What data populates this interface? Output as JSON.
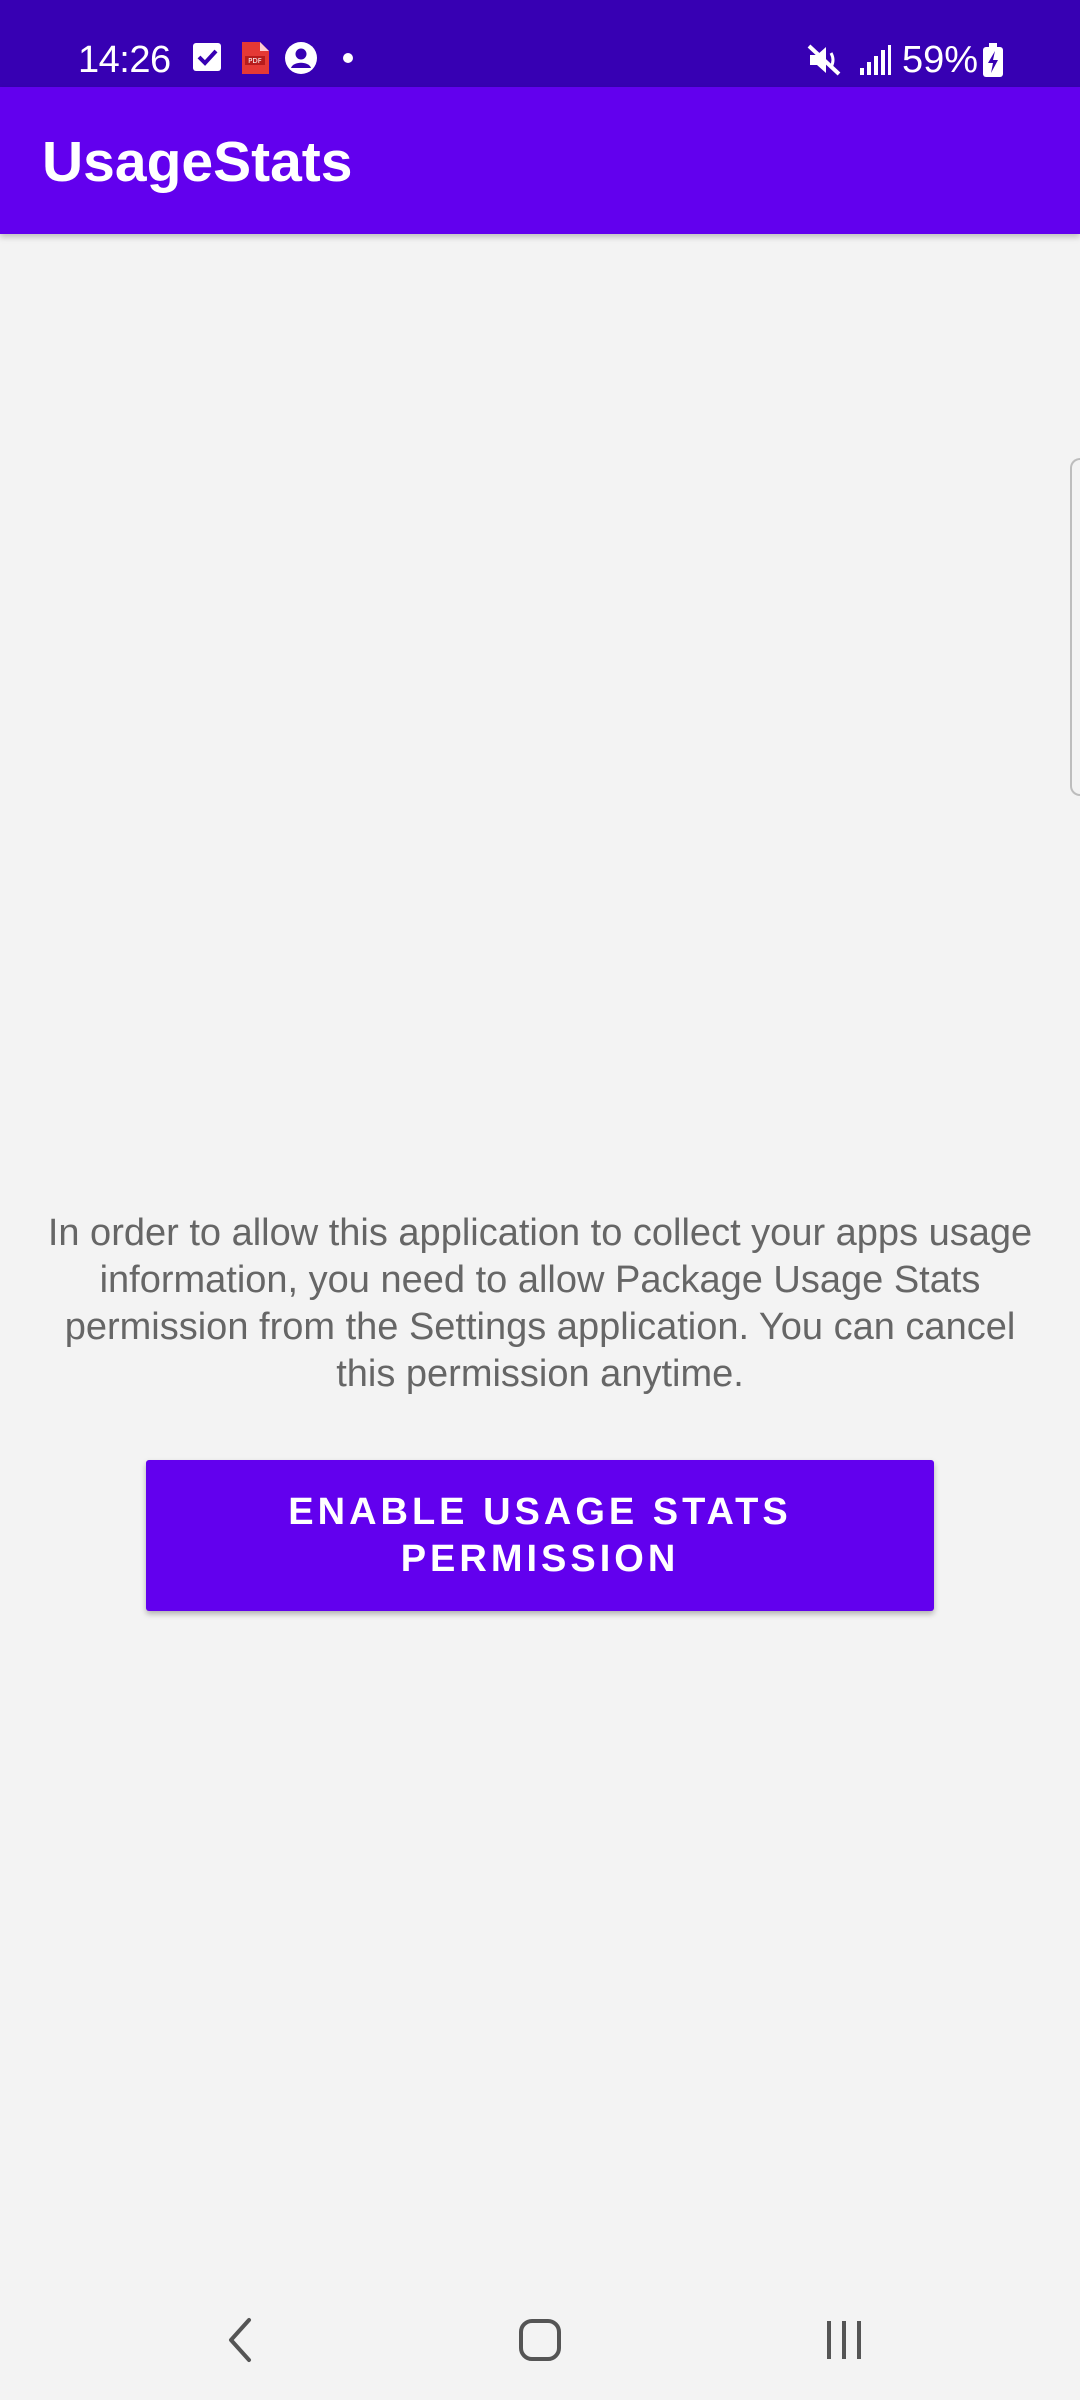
{
  "status_bar": {
    "time": "14:26",
    "battery": "59%",
    "left_icons": [
      "checkbox-icon",
      "pdf-icon",
      "account-icon",
      "dot-icon"
    ],
    "right_icons": [
      "mute-icon",
      "signal-icon",
      "battery-charging-icon"
    ]
  },
  "app_bar": {
    "title": "UsageStats"
  },
  "main": {
    "message": "In order to allow this application to collect your apps usage information, you need to allow Package Usage Stats permission from the Settings application. You can cancel this permission anytime.",
    "button_label": "ENABLE USAGE STATS PERMISSION"
  },
  "nav_bar": {
    "buttons": [
      "back-icon",
      "home-icon",
      "recents-icon"
    ]
  },
  "colors": {
    "status_bar": "#3700b3",
    "primary": "#6200ee",
    "background": "#f3f3f3",
    "text_secondary": "#666666"
  }
}
